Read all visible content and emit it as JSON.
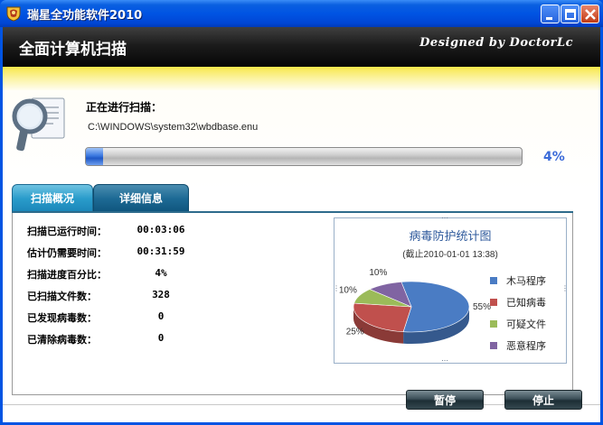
{
  "window": {
    "title": "瑞星全功能软件2010",
    "controls": {
      "minimize": "minimize",
      "maximize": "maximize",
      "close": "close"
    }
  },
  "banner": {
    "title": "全面计算机扫描",
    "credit": "Designed by DoctorLc"
  },
  "scan": {
    "label": "正在进行扫描：",
    "current_file": "C:\\WINDOWS\\system32\\wbdbase.enu",
    "progress_percent": 4,
    "progress_text": "4%"
  },
  "tabs": [
    {
      "label": "扫描概况",
      "active": true
    },
    {
      "label": "详细信息",
      "active": false
    }
  ],
  "stats": [
    {
      "label": "扫描已运行时间：",
      "value": "00:03:06"
    },
    {
      "label": "估计仍需要时间：",
      "value": "00:31:59"
    },
    {
      "label": "扫描进度百分比：",
      "value": "4%"
    },
    {
      "label": "已扫描文件数：",
      "value": "328"
    },
    {
      "label": "已发现病毒数：",
      "value": "0"
    },
    {
      "label": "已清除病毒数：",
      "value": "0"
    }
  ],
  "chart_data": {
    "type": "pie",
    "title": "病毒防护统计图",
    "subtitle": "(截止2010-01-01 13:38)",
    "categories": [
      "木马程序",
      "已知病毒",
      "可疑文件",
      "恶意程序"
    ],
    "values": [
      55,
      25,
      10,
      10
    ],
    "data_labels": [
      "55%",
      "25%",
      "10%",
      "10%"
    ],
    "colors": [
      "#4a7cc4",
      "#c0504d",
      "#9bbb59",
      "#8064a2"
    ],
    "legend_position": "right"
  },
  "buttons": {
    "pause": "暂停",
    "stop": "停止"
  }
}
